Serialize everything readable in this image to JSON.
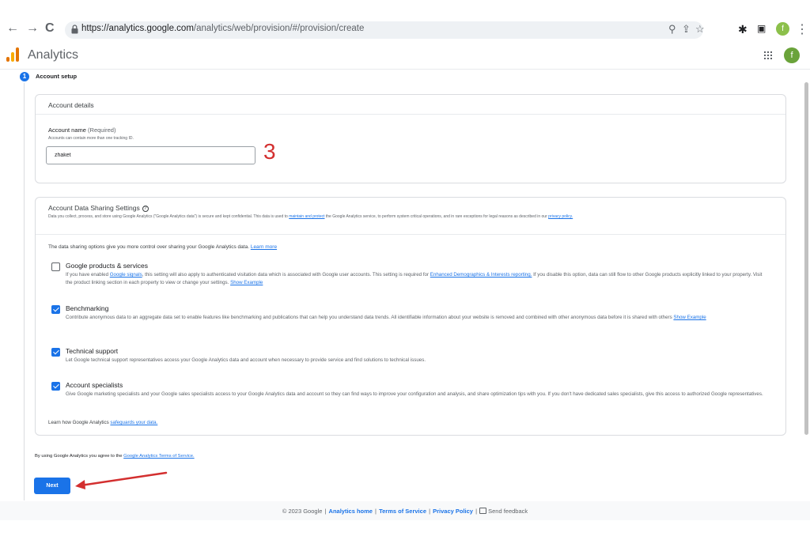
{
  "browser": {
    "url_host": "https://analytics.google.com",
    "url_path": "/analytics/web/provision/#/provision/create",
    "profile_initial": "f"
  },
  "icons": {
    "back": "back-arrow-icon",
    "forward": "forward-arrow-icon",
    "reload": "reload-icon",
    "lock": "lock-icon",
    "zoom": "zoom-icon",
    "share": "share-icon",
    "star": "star-icon",
    "extensions": "puzzle-icon",
    "sidepanel": "side-panel-icon",
    "menu": "kebab-menu-icon",
    "apps": "apps-grid-icon",
    "help": "help-circle-icon",
    "feedback": "feedback-icon"
  },
  "app": {
    "title": "Analytics",
    "avatar_initial": "f"
  },
  "stepper": {
    "number": "1",
    "label": "Account setup"
  },
  "account_details": {
    "title": "Account details",
    "name_label": "Account name",
    "name_required": "(Required)",
    "name_hint": "Accounts can contain more than one tracking ID.",
    "name_value": "zhaket"
  },
  "annotation": {
    "number": "3",
    "color": "#d32f2f"
  },
  "sharing": {
    "title": "Account Data Sharing Settings",
    "desc_before": "Data you collect, process, and store using Google Analytics (\"Google Analytics data\") is secure and kept confidential. This data is used to ",
    "desc_link1": "maintain and protect",
    "desc_after": " the Google Analytics service, to perform system critical operations, and in rare exceptions for legal reasons as described in our ",
    "desc_link2": "privacy policy.",
    "intro": "The data sharing options give you more control over sharing your Google Analytics data.",
    "intro_link": "Learn more",
    "options": [
      {
        "title": "Google products & services",
        "checked": false,
        "desc_a": "If you have enabled ",
        "link_a": "Google signals",
        "desc_b": ", this setting will also apply to authenticated visitation data which is associated with Google user accounts. This setting is required for ",
        "link_b": "Enhanced Demographics & Interests reporting.",
        "desc_c": " If you disable this option, data can still flow to other Google products explicitly linked to your property. Visit the product linking section in each property to view or change your settings. ",
        "link_c": "Show Example"
      },
      {
        "title": "Benchmarking",
        "checked": true,
        "desc": "Contribute anonymous data to an aggregate data set to enable features like benchmarking and publications that can help you understand data trends. All identifiable information about your website is removed and combined with other anonymous data before it is shared with others ",
        "link": "Show Example"
      },
      {
        "title": "Technical support",
        "checked": true,
        "desc": "Let Google technical support representatives access your Google Analytics data and account when necessary to provide service and find solutions to technical issues."
      },
      {
        "title": "Account specialists",
        "checked": true,
        "desc": "Give Google marketing specialists and your Google sales specialists access to your Google Analytics data and account so they can find ways to improve your configuration and analysis, and share optimization tips with you. If you don't have dedicated sales specialists, give this access to authorized Google representatives."
      }
    ],
    "safeguards_text": "Learn how Google Analytics ",
    "safeguards_link": "safeguards your data."
  },
  "terms": {
    "text": "By using Google Analytics you agree to the ",
    "link": "Google Analytics Terms of Service."
  },
  "next_label": "Next",
  "footer": {
    "copyright": "© 2023 Google",
    "analytics_home": "Analytics home",
    "terms": "Terms of Service",
    "privacy": "Privacy Policy",
    "feedback": "Send feedback"
  }
}
